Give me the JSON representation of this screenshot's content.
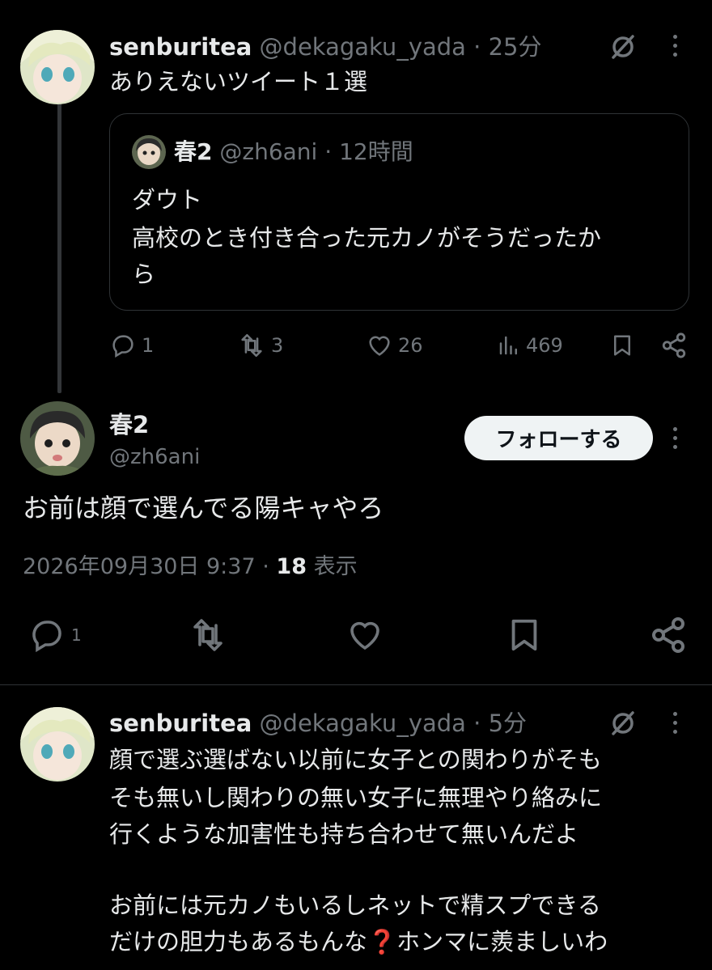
{
  "tweet1": {
    "name": "senburitea",
    "handle": "@dekagaku_yada",
    "time": "25分",
    "text": "ありえないツイート１選",
    "quote": {
      "name": "春2",
      "handle": "@zh6ani",
      "time": "12時間",
      "lines": [
        "ダウト",
        "高校のとき付き合った元カノがそうだったか",
        "ら"
      ]
    },
    "actions": {
      "replies": "1",
      "retweets": "3",
      "likes": "26",
      "views": "469"
    }
  },
  "main_tweet": {
    "name": "春2",
    "handle": "@zh6ani",
    "follow_label": "フォローする",
    "text": "お前は顔で選んでる陽キャやろ",
    "date": "2026年09月30日 9:37",
    "views_count": "18",
    "views_label": "表示",
    "reply_count": "1"
  },
  "tweet3": {
    "name": "senburitea",
    "handle": "@dekagaku_yada",
    "time": "5分",
    "lines": [
      "顔で選ぶ選ばない以前に女子との関わりがそも",
      "そも無いし関わりの無い女子に無理やり絡みに",
      "行くような加害性も持ち合わせて無いんだよ",
      "",
      "お前には元カノもいるしネットで精スプできる",
      "だけの胆力もあるもんな❓ホンマに羨ましいわ"
    ]
  },
  "icons": {
    "reply": "reply-icon",
    "retweet": "retweet-icon",
    "like": "heart-icon",
    "views": "views-icon",
    "bookmark": "bookmark-icon",
    "share": "share-icon",
    "grok": "grok-icon",
    "more": "more-icon"
  },
  "colors": {
    "background": "#000000",
    "text": "#e7e9ea",
    "muted": "#71767b",
    "border": "#2f3336"
  }
}
